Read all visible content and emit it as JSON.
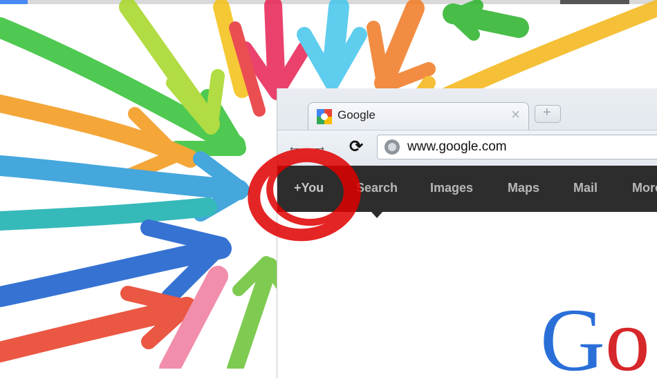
{
  "browser": {
    "tab": {
      "title": "Google",
      "close_glyph": "×",
      "favicon": "google-favicon"
    },
    "newtab_glyph": "+",
    "nav": {
      "back_glyph": "←",
      "forward_glyph": "→",
      "reload_glyph": "⟳"
    },
    "omnibox": {
      "url": "www.google.com",
      "icon": "globe-icon"
    }
  },
  "gbar": {
    "items": [
      "+You",
      "Search",
      "Images",
      "Maps",
      "Mail",
      "More"
    ]
  },
  "logo": {
    "letters": [
      "G",
      "o"
    ]
  },
  "colors": {
    "gbar_bg": "#2d2d2d",
    "gbar_text": "#b8b8b8",
    "logo_blue": "#2a6fd8",
    "logo_red": "#d6272a",
    "annotation_red": "#e00000"
  }
}
